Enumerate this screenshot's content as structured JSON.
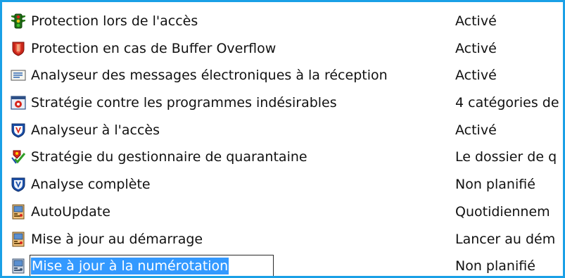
{
  "items": [
    {
      "icon": "traffic-light-icon",
      "name": "Protection lors de l'accès",
      "status": "Activé"
    },
    {
      "icon": "buffer-overflow-shield-icon",
      "name": "Protection en cas de Buffer Overflow",
      "status": "Activé"
    },
    {
      "icon": "email-scanner-icon",
      "name": "Analyseur des messages électroniques à la réception",
      "status": "Activé"
    },
    {
      "icon": "unwanted-programs-policy-icon",
      "name": "Stratégie contre les programmes indésirables",
      "status": "4 catégories de"
    },
    {
      "icon": "mcafee-shield-icon",
      "name": "Analyseur à l'accès",
      "status": "Activé"
    },
    {
      "icon": "quarantine-manager-icon",
      "name": "Stratégie du gestionnaire de quarantaine",
      "status": "Le dossier de q"
    },
    {
      "icon": "full-scan-shield-icon",
      "name": "Analyse complète",
      "status": "Non planifié"
    },
    {
      "icon": "autoupdate-icon",
      "name": "AutoUpdate",
      "status": "Quotidiennem"
    },
    {
      "icon": "update-at-startup-icon",
      "name": "Mise à jour au démarrage",
      "status": "Lancer au dém"
    },
    {
      "icon": "dialup-update-icon",
      "name": "Mise à jour à la numérotation",
      "status": "Non planifié"
    }
  ],
  "editing_index": 9,
  "colors": {
    "border": "#1aa0e6",
    "selection": "#3399ff"
  }
}
